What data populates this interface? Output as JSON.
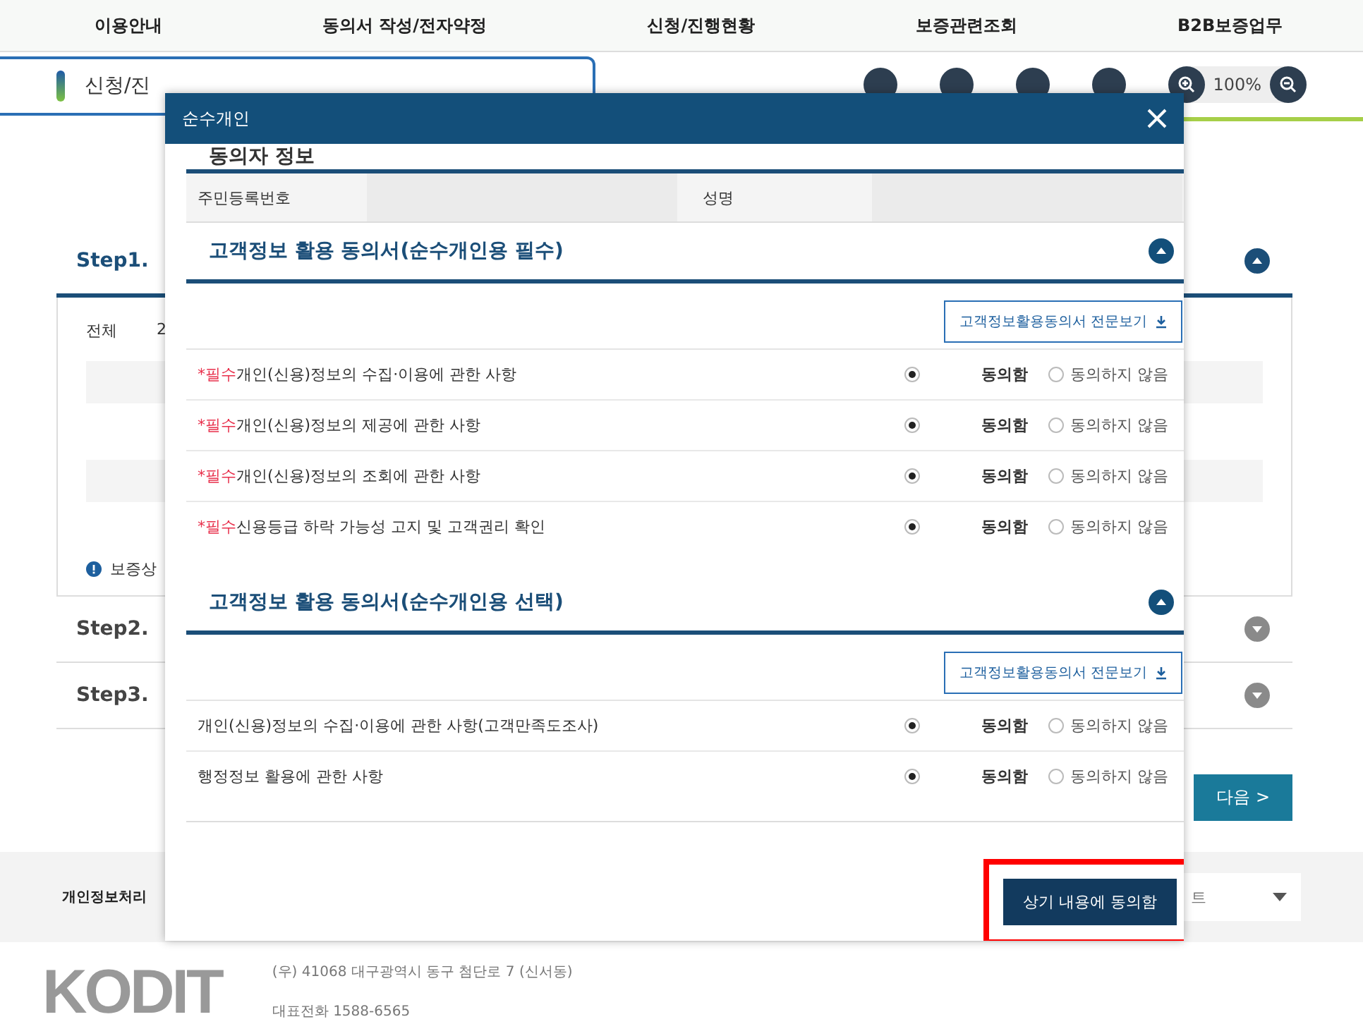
{
  "top_nav": [
    {
      "label": "이용안내"
    },
    {
      "label": "동의서 작성/전자약정"
    },
    {
      "label": "신청/진행현황"
    },
    {
      "label": "보증관련조회"
    },
    {
      "label": "B2B보증업무"
    }
  ],
  "page_title": "신청/진",
  "zoom_level": "100%",
  "steps": [
    {
      "label": "Step1.",
      "expanded": true
    },
    {
      "label": "Step2.",
      "expanded": false
    },
    {
      "label": "Step3.",
      "expanded": false
    }
  ],
  "summary": {
    "total_label": "전체",
    "count": "2"
  },
  "notice": "보증상",
  "next_button": "다음 >",
  "footer": {
    "privacy_link": "개인정보처리",
    "select_value": "트",
    "logo": "KODIT",
    "address": "(우) 41068 대구광역시 동구 첨단로 7 (신서동)",
    "phone": "대표전화 1588-6565"
  },
  "modal": {
    "title": "순수개인",
    "consenter": {
      "heading": "동의자 정보",
      "fields": [
        {
          "label": "주민등록번호"
        },
        {
          "label": "성명"
        }
      ]
    },
    "sections": [
      {
        "title": "고객정보 활용 동의서(순수개인용 필수)",
        "expanded": true,
        "view_button": "고객정보활용동의서 전문보기",
        "items": [
          {
            "tag": "*필수",
            "text": "개인(신용)정보의 수집·이용에 관한 사항",
            "options": [
              {
                "label": "동의함",
                "selected": true
              },
              {
                "label": "동의하지 않음",
                "selected": false
              }
            ]
          },
          {
            "tag": "*필수",
            "text": "개인(신용)정보의 제공에 관한 사항",
            "options": [
              {
                "label": "동의함",
                "selected": true
              },
              {
                "label": "동의하지 않음",
                "selected": false
              }
            ]
          },
          {
            "tag": "*필수",
            "text": "개인(신용)정보의 조회에 관한 사항",
            "options": [
              {
                "label": "동의함",
                "selected": true
              },
              {
                "label": "동의하지 않음",
                "selected": false
              }
            ]
          },
          {
            "tag": "*필수",
            "text": "신용등급 하락 가능성 고지 및 고객권리 확인",
            "options": [
              {
                "label": "동의함",
                "selected": true
              },
              {
                "label": "동의하지 않음",
                "selected": false
              }
            ]
          }
        ]
      },
      {
        "title": "고객정보 활용 동의서(순수개인용 선택)",
        "expanded": true,
        "view_button": "고객정보활용동의서 전문보기",
        "items": [
          {
            "text": "개인(신용)정보의 수집·이용에 관한 사항(고객만족도조사)",
            "options": [
              {
                "label": "동의함",
                "selected": true
              },
              {
                "label": "동의하지 않음",
                "selected": false
              }
            ]
          },
          {
            "text": "행정정보 활용에 관한 사항",
            "options": [
              {
                "label": "동의함",
                "selected": true
              },
              {
                "label": "동의하지 않음",
                "selected": false
              }
            ]
          }
        ]
      }
    ],
    "submit_button": "상기 내용에 동의함",
    "submit_highlighted": true
  }
}
